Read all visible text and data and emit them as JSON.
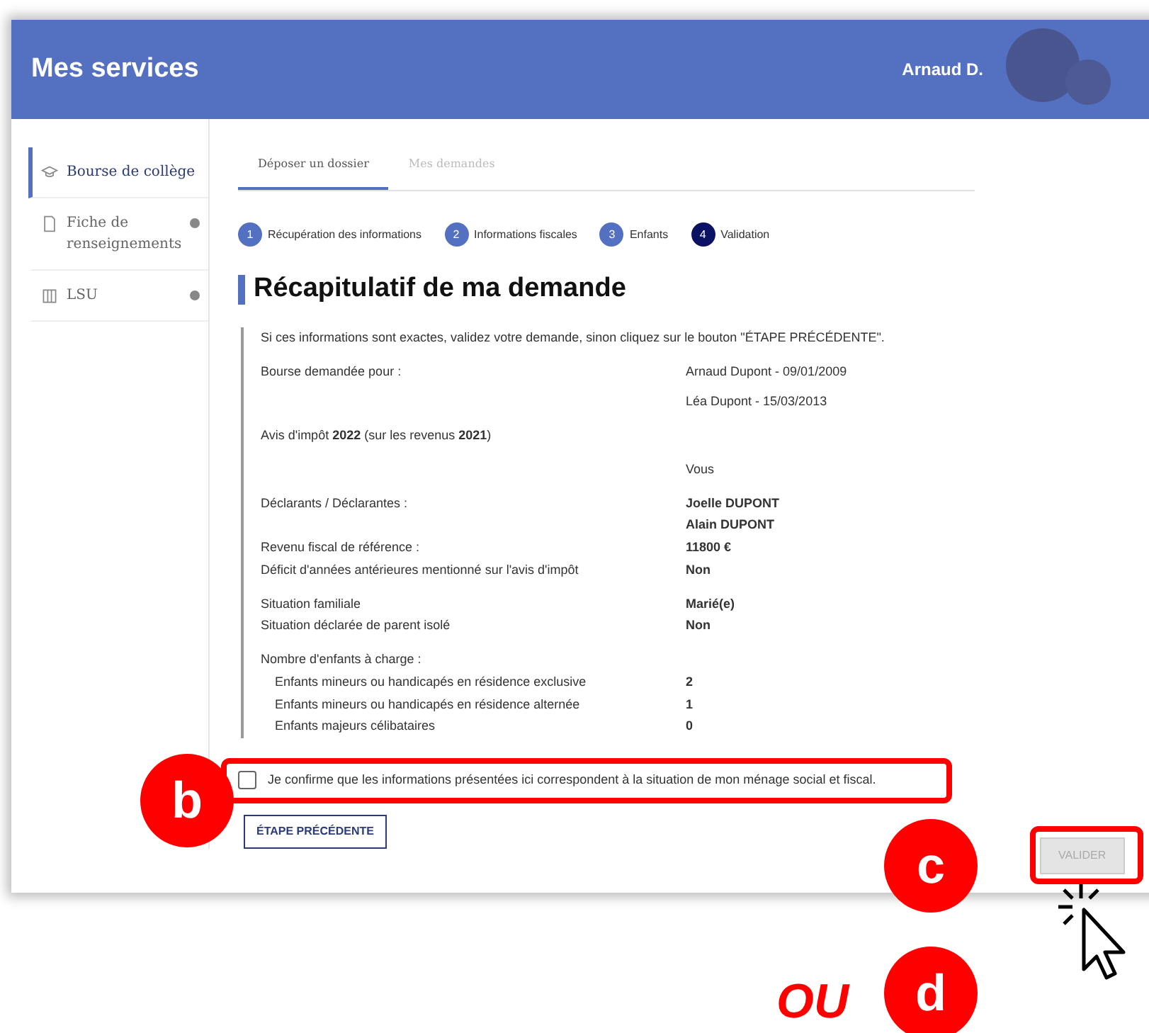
{
  "header": {
    "title": "Mes services",
    "user": "Arnaud D."
  },
  "sidebar": {
    "items": [
      {
        "label": "Bourse de collège",
        "selected": true,
        "kind": "plain"
      },
      {
        "label": "Fiche de renseignements",
        "selected": false,
        "kind": "info"
      },
      {
        "label": "LSU",
        "selected": false,
        "kind": "info"
      }
    ]
  },
  "tabs": [
    {
      "label": "Déposer un dossier",
      "selected": true
    },
    {
      "label": "Mes demandes",
      "selected": false
    }
  ],
  "steps": [
    {
      "number": "1",
      "label": "Récupération des informations",
      "selected": false
    },
    {
      "number": "2",
      "label": "Informations fiscales",
      "selected": false
    },
    {
      "number": "3",
      "label": "Enfants",
      "selected": false
    },
    {
      "number": "4",
      "label": "Validation",
      "selected": true
    }
  ],
  "heading": "Récapitulatif de ma demande",
  "intro": "Si ces informations sont exactes, validez votre demande, sinon cliquez sur le bouton \"ÉTAPE PRÉCÉDENTE\".",
  "groups": [
    {
      "kind": "plain",
      "rows": [
        {
          "label": "Bourse demandée pour :",
          "values": [
            "Arnaud Dupont - 09/01/2009"
          ]
        },
        {
          "values": [
            "Léa Dupont - 15/03/2013"
          ]
        }
      ]
    },
    {
      "kind": "note",
      "rows": [
        {
          "label": "Avis d'impôt **2022** (sur les revenus **2021**)"
        }
      ]
    },
    {
      "kind": "strong",
      "column_header": "Vous",
      "rows": [
        {
          "label": "Déclarants / Déclarantes :",
          "values": [
            "Joelle DUPONT",
            "Alain DUPONT"
          ]
        },
        {
          "label": "Revenu fiscal de référence :",
          "values": [
            "11800 €"
          ]
        },
        {
          "label": "Déficit d'années antérieures mentionné sur l'avis d'impôt",
          "values": [
            "Non"
          ]
        }
      ]
    },
    {
      "kind": "strong",
      "rows": [
        {
          "label": "Situation familiale",
          "values": [
            "Marié(e)"
          ]
        },
        {
          "label": "Situation déclarée de parent isolé",
          "values": [
            "Non"
          ]
        }
      ]
    },
    {
      "kind": "strong",
      "rows": [
        {
          "label": "Nombre d'enfants à charge :",
          "children": [
            {
              "label": "Enfants mineurs ou handicapés en résidence exclusive",
              "values": [
                "2"
              ]
            },
            {
              "label": "Enfants mineurs ou handicapés en résidence alternée",
              "values": [
                "1"
              ]
            },
            {
              "label": "Enfants majeurs célibataires",
              "values": [
                "0"
              ]
            }
          ]
        }
      ]
    }
  ],
  "confirmation": {
    "label": "Je confirme que les informations présentées ici correspondent à la situation de mon ménage social et fiscal.",
    "checked": false
  },
  "buttons": [
    {
      "label": "ÉTAPE PRÉCÉDENTE"
    },
    {
      "label": "VALIDER",
      "disabled": true
    }
  ],
  "annotations": {
    "markers": [
      "b",
      "c",
      "d"
    ],
    "or_text": "OU"
  }
}
